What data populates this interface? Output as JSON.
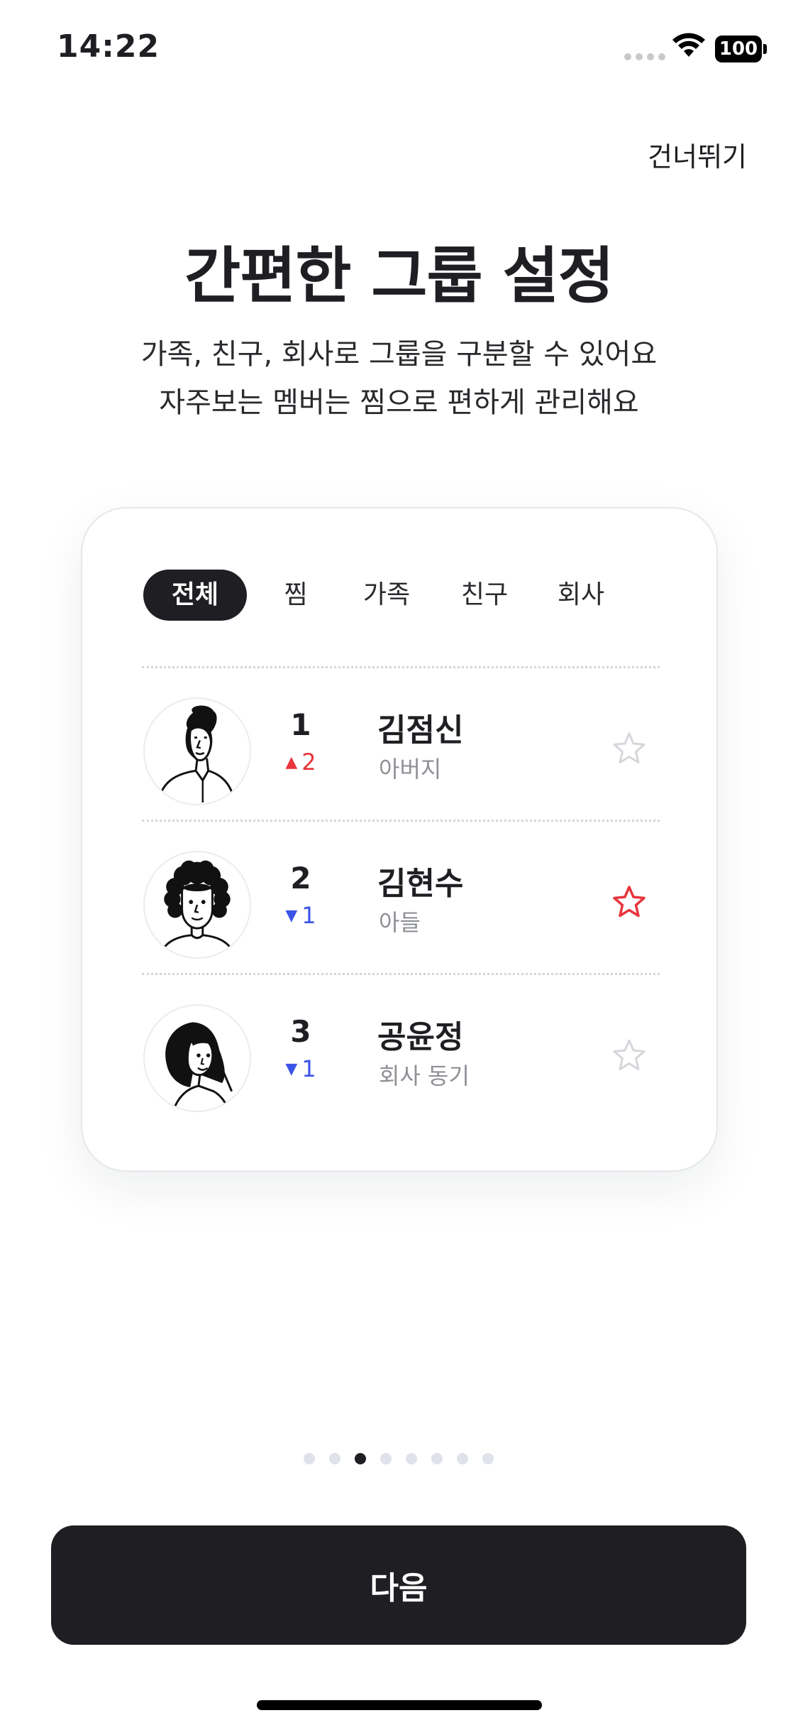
{
  "status_bar": {
    "time": "14:22",
    "battery": "100"
  },
  "skip_label": "건너뛰기",
  "title": "간편한 그룹 설정",
  "subtitle_lines": [
    "가족, 친구, 회사로 그룹을 구분할 수 있어요",
    "자주보는 멤버는 찜으로 편하게 관리해요"
  ],
  "filter_chips": [
    {
      "label": "전체",
      "active": true
    },
    {
      "label": "찜",
      "active": false
    },
    {
      "label": "가족",
      "active": false
    },
    {
      "label": "친구",
      "active": false
    },
    {
      "label": "회사",
      "active": false
    }
  ],
  "members": [
    {
      "rank": "1",
      "change": "2",
      "direction": "up",
      "name": "김점신",
      "relation": "아버지",
      "favorite": false,
      "avatar": "man-with-quiff-avatar"
    },
    {
      "rank": "2",
      "change": "1",
      "direction": "down",
      "name": "김현수",
      "relation": "아들",
      "favorite": true,
      "avatar": "curly-hair-man-avatar"
    },
    {
      "rank": "3",
      "change": "1",
      "direction": "down",
      "name": "공윤정",
      "relation": "회사 동기",
      "favorite": false,
      "avatar": "woman-long-hair-avatar"
    }
  ],
  "pagination": {
    "total": 8,
    "current": 3
  },
  "next_label": "다음",
  "colors": {
    "primary_dark": "#1f1f23",
    "up": "#e8343b",
    "down": "#3b54e8",
    "favorite": "#e8343b",
    "star_inactive": "#d6d7db"
  }
}
